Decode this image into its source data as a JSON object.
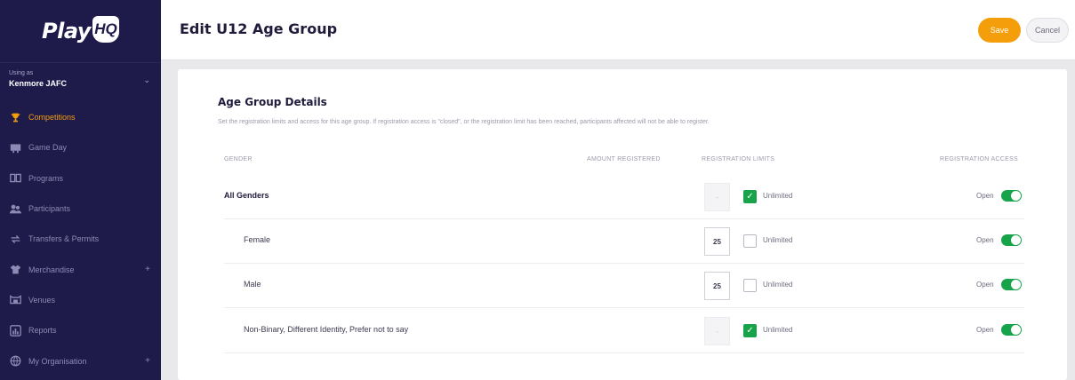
{
  "brand": {
    "logo_text": "Play",
    "logo_badge": "HQ"
  },
  "org": {
    "using_label": "Using as",
    "name": "Kenmore JAFC"
  },
  "nav": [
    {
      "label": "Competitions",
      "icon": "trophy-icon",
      "active": true,
      "expandable": false
    },
    {
      "label": "Game Day",
      "icon": "scoreboard-icon",
      "active": false,
      "expandable": false
    },
    {
      "label": "Programs",
      "icon": "book-icon",
      "active": false,
      "expandable": false
    },
    {
      "label": "Participants",
      "icon": "people-icon",
      "active": false,
      "expandable": false
    },
    {
      "label": "Transfers & Permits",
      "icon": "transfer-icon",
      "active": false,
      "expandable": false
    },
    {
      "label": "Merchandise",
      "icon": "shirt-icon",
      "active": false,
      "expandable": true
    },
    {
      "label": "Venues",
      "icon": "stadium-icon",
      "active": false,
      "expandable": false
    },
    {
      "label": "Reports",
      "icon": "report-icon",
      "active": false,
      "expandable": false
    },
    {
      "label": "My Organisation",
      "icon": "organisation-icon",
      "active": false,
      "expandable": true
    }
  ],
  "header": {
    "title": "Edit U12 Age Group",
    "save_label": "Save",
    "cancel_label": "Cancel"
  },
  "section": {
    "title": "Age Group Details",
    "description": "Set the registration limits and access for this age group. If registration access is \"closed\", or the registration limit has been reached, participants affected will not be able to register."
  },
  "columns": {
    "gender": "GENDER",
    "amount_registered": "AMOUNT REGISTERED",
    "registration_limits": "REGISTRATION LIMITS",
    "registration_access": "REGISTRATION ACCESS"
  },
  "rows": [
    {
      "gender": "All Genders",
      "limit": "-",
      "unlimited": true,
      "unlimited_label": "Unlimited",
      "access": "Open",
      "access_on": true
    },
    {
      "gender": "Female",
      "limit": "25",
      "unlimited": false,
      "unlimited_label": "Unlimited",
      "access": "Open",
      "access_on": true
    },
    {
      "gender": "Male",
      "limit": "25",
      "unlimited": false,
      "unlimited_label": "Unlimited",
      "access": "Open",
      "access_on": true
    },
    {
      "gender": "Non-Binary, Different Identity, Prefer not to say",
      "limit": "-",
      "unlimited": true,
      "unlimited_label": "Unlimited",
      "access": "Open",
      "access_on": true
    }
  ],
  "colors": {
    "sidebar": "#1e1b4b",
    "accent": "#f59e0b",
    "toggle_on": "#16a34a"
  }
}
